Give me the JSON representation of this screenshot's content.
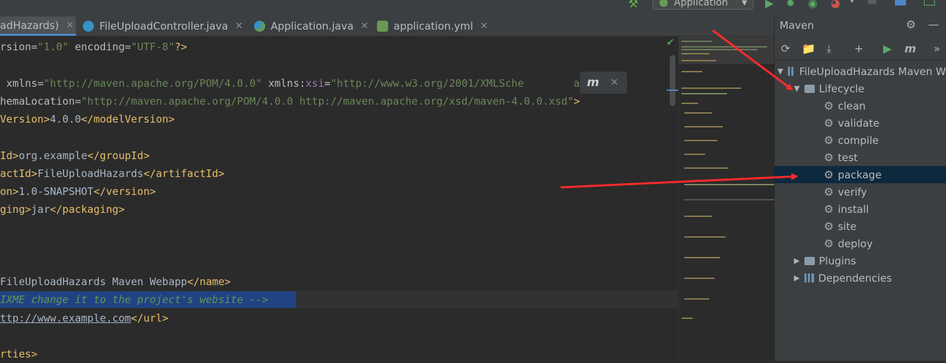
{
  "toolbar": {
    "run_config_label": "Application"
  },
  "tabs": [
    {
      "label": "adHazards)",
      "icon": "maven-file-icon",
      "active": true
    },
    {
      "label": "FileUploadController.java",
      "icon": "java-class-icon"
    },
    {
      "label": "Application.java",
      "icon": "spring-boot-class-icon"
    },
    {
      "label": "application.yml",
      "icon": "spring-yaml-icon"
    }
  ],
  "code": {
    "l1": {
      "a": "rsion",
      "b": "=",
      "c": "\"1.0\"",
      "d": " encoding",
      "e": "=",
      "f": "\"UTF-8\"",
      "g": "?>"
    },
    "l3": {
      "a": " xmlns",
      "b": "=",
      "c": "\"http://maven.apache.org/POM/4.0.0\"",
      "d": " xmlns",
      "e": ":",
      "f": "xsi",
      "g": "=",
      "h": "\"http://www.w3.org/2001/XMLSche",
      "i": "ance\""
    },
    "l4": {
      "a": "hemaLocation",
      "b": "=",
      "c": "\"http://maven.apache.org/POM/4.0.0 http://maven.apache.org/xsd/maven-4.0.0.xsd\"",
      "d": ">"
    },
    "l5": {
      "a": "Version>",
      "b": "4.0.0",
      "c": "</modelVersion>"
    },
    "l7": {
      "a": "Id>",
      "b": "org.example",
      "c": "</groupId>"
    },
    "l8": {
      "a": "actId>",
      "b": "FileUploadHazards",
      "c": "</artifactId>"
    },
    "l9": {
      "a": "on>",
      "b": "1.0-SNAPSHOT",
      "c": "</version>"
    },
    "l10": {
      "a": "ging>",
      "b": "jar",
      "c": "</packaging>"
    },
    "l14": {
      "a": "FileUploadHazards Maven Webapp",
      "b": "</name>"
    },
    "l15": {
      "a": "IXME change it to the project's website -->"
    },
    "l16": {
      "a": "ttp://www.example.com",
      "b": "</url>"
    },
    "l18": {
      "a": "rties>"
    }
  },
  "maven_popup": {
    "icon": "maven-reload-icon"
  },
  "maven": {
    "title": "Maven",
    "project": "FileUploadHazards Maven W",
    "lifecycle": "Lifecycle",
    "goals": [
      "clean",
      "validate",
      "compile",
      "test",
      "package",
      "verify",
      "install",
      "site",
      "deploy"
    ],
    "selected_goal": "package",
    "plugins": "Plugins",
    "dependencies": "Dependencies"
  },
  "colors": {
    "selection": "#0d293e",
    "accent": "#4a88c7",
    "annotation_arrow": "#ff2a2a"
  }
}
